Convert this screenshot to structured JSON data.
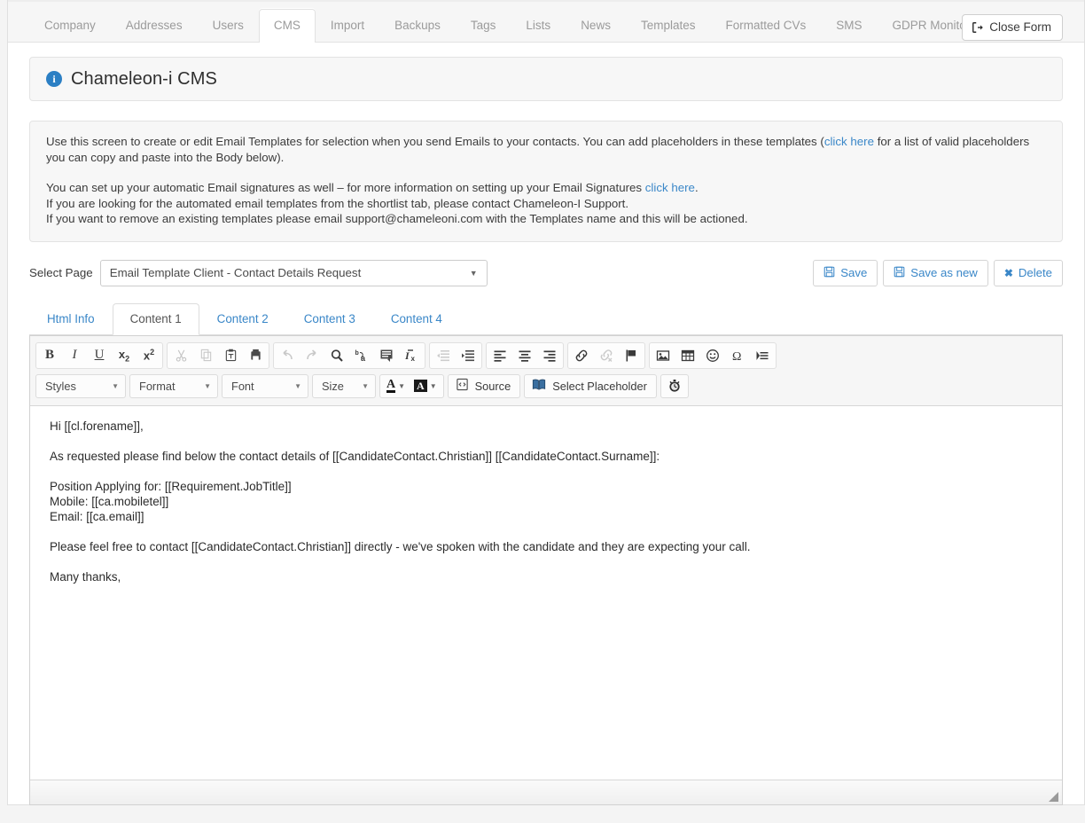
{
  "nav": {
    "tabs": [
      {
        "label": "Company",
        "active": false
      },
      {
        "label": "Addresses",
        "active": false
      },
      {
        "label": "Users",
        "active": false
      },
      {
        "label": "CMS",
        "active": true
      },
      {
        "label": "Import",
        "active": false
      },
      {
        "label": "Backups",
        "active": false
      },
      {
        "label": "Tags",
        "active": false
      },
      {
        "label": "Lists",
        "active": false
      },
      {
        "label": "News",
        "active": false
      },
      {
        "label": "Templates",
        "active": false
      },
      {
        "label": "Formatted CVs",
        "active": false
      },
      {
        "label": "SMS",
        "active": false
      },
      {
        "label": "GDPR Monitor",
        "active": false
      }
    ],
    "close_form_label": "Close Form",
    "close_form_icon": "logout-icon"
  },
  "heading": {
    "info_icon": "info-icon",
    "info_glyph": "i",
    "title": "Chameleon-i CMS"
  },
  "info_box": {
    "line1_a": "Use this screen to create or edit Email Templates for selection when you send Emails to your contacts. You can add placeholders in these templates (",
    "line1_link": "click here",
    "line1_b": " for a list of valid placeholders you can copy and paste into the Body below).",
    "line2_a": "You can set up your automatic Email signatures as well – for more information on setting up your Email Signatures ",
    "line2_link": "click here",
    "line2_b": ".",
    "line3": "If you are looking for the automated email templates from the shortlist tab, please contact Chameleon-I Support.",
    "line4": "If you want to remove an existing templates please email support@chameleoni.com with the Templates name and this will be actioned."
  },
  "select_row": {
    "label": "Select Page",
    "selected_value": "Email Template Client - Contact Details Request",
    "caret_icon": "chevron-down-icon",
    "buttons": [
      {
        "label": "Save",
        "icon": "save-disk-icon"
      },
      {
        "label": "Save as new",
        "icon": "save-disk-icon"
      },
      {
        "label": "Delete",
        "icon": "x-icon"
      }
    ]
  },
  "content_tabs": [
    {
      "label": "Html Info",
      "active": false
    },
    {
      "label": "Content 1",
      "active": true
    },
    {
      "label": "Content 2",
      "active": false
    },
    {
      "label": "Content 3",
      "active": false
    },
    {
      "label": "Content 4",
      "active": false
    }
  ],
  "editor": {
    "toolbar_row1": [
      {
        "group": [
          {
            "name": "bold-icon",
            "kind": "glyph-b",
            "text": "B",
            "disabled": false
          },
          {
            "name": "italic-icon",
            "kind": "glyph-i",
            "text": "I",
            "disabled": false
          },
          {
            "name": "underline-icon",
            "kind": "glyph-u",
            "text": "U",
            "disabled": false
          },
          {
            "name": "subscript-icon",
            "kind": "glyph-sub",
            "text": "x",
            "disabled": false
          },
          {
            "name": "superscript-icon",
            "kind": "glyph-sup",
            "text": "x",
            "disabled": false
          }
        ]
      },
      {
        "group": [
          {
            "name": "cut-icon",
            "disabled": true
          },
          {
            "name": "copy-icon",
            "disabled": true
          },
          {
            "name": "paste-icon",
            "disabled": false
          },
          {
            "name": "paste-from-word-icon",
            "disabled": false
          }
        ]
      },
      {
        "group": [
          {
            "name": "undo-icon",
            "disabled": true
          },
          {
            "name": "redo-icon",
            "disabled": true
          },
          {
            "name": "find-icon",
            "disabled": false
          },
          {
            "name": "replace-icon",
            "disabled": false
          },
          {
            "name": "select-all-icon",
            "disabled": false
          },
          {
            "name": "remove-format-icon",
            "disabled": false
          }
        ]
      },
      {
        "group": [
          {
            "name": "outdent-icon",
            "disabled": true
          },
          {
            "name": "indent-icon",
            "disabled": false
          }
        ]
      },
      {
        "group": [
          {
            "name": "align-left-icon",
            "disabled": false
          },
          {
            "name": "align-center-icon",
            "disabled": false
          },
          {
            "name": "align-right-icon",
            "disabled": false
          }
        ]
      },
      {
        "group": [
          {
            "name": "link-icon",
            "disabled": false
          },
          {
            "name": "unlink-icon",
            "disabled": true
          },
          {
            "name": "anchor-flag-icon",
            "disabled": false
          }
        ]
      },
      {
        "group": [
          {
            "name": "image-icon",
            "disabled": false
          },
          {
            "name": "table-icon",
            "disabled": false
          },
          {
            "name": "smiley-icon",
            "disabled": false
          },
          {
            "name": "special-char-icon",
            "disabled": false
          },
          {
            "name": "page-break-icon",
            "disabled": false
          }
        ]
      }
    ],
    "dropdowns": [
      {
        "label": "Styles",
        "name": "styles-dropdown"
      },
      {
        "label": "Format",
        "name": "format-dropdown"
      },
      {
        "label": "Font",
        "name": "font-dropdown"
      },
      {
        "label": "Size",
        "name": "size-dropdown"
      }
    ],
    "text_color_icon": "text-color-icon",
    "bg_color_icon": "background-color-icon",
    "source_label": "Source",
    "source_icon": "source-code-icon",
    "placeholder_label": "Select Placeholder",
    "placeholder_icon": "book-icon",
    "timer_icon": "timer-icon",
    "resize_grip_icon": "resize-grip-icon",
    "content": {
      "p1": "Hi [[cl.forename]],",
      "p2": "As requested please find below the contact details of [[CandidateContact.Christian]] [[CandidateContact.Surname]]:",
      "p3a": "Position Applying for: [[Requirement.JobTitle]]",
      "p3b": "Mobile: [[ca.mobiletel]]",
      "p3c": "Email: [[ca.email]]",
      "p4": "Please feel free to contact [[CandidateContact.Christian]] directly - we've spoken with the candidate and they are expecting your call.",
      "p5": "Many thanks,"
    }
  },
  "colors": {
    "link": "#3a87c8",
    "info_badge": "#2b7fc4",
    "page_bg": "#f4f4f4",
    "panel_bg": "#f7f7f7"
  }
}
